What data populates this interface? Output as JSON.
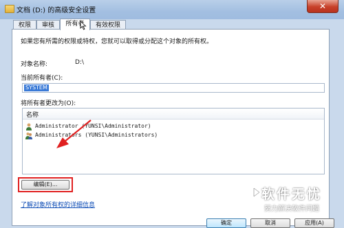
{
  "window": {
    "title": "文档 (D:) 的高级安全设置",
    "close_label": "✕"
  },
  "tabs": [
    {
      "label": "权限",
      "active": false
    },
    {
      "label": "审核",
      "active": false
    },
    {
      "label": "所有者",
      "active": true
    },
    {
      "label": "有效权限",
      "active": false
    }
  ],
  "panel": {
    "intro": "如果您有所需的权限或特权，您就可以取得或分配这个对象的所有权。",
    "object_label": "对象名称:",
    "object_value": "D:\\",
    "current_owner_label": "当前所有者(C):",
    "current_owner_value": "SYSTEM",
    "change_owner_label": "将所有者更改为(O):",
    "list_header": "名称",
    "owners": [
      {
        "name": "Administrator (YUNSI\\Administrator)",
        "icon": "user-icon"
      },
      {
        "name": "Administrators (YUNSI\\Administrators)",
        "icon": "group-icon"
      }
    ],
    "edit_button": "编辑(E)...",
    "learn_more_link": "了解对象所有权的详细信息"
  },
  "buttons": {
    "ok": "确定",
    "cancel": "取消",
    "apply": "应用(A)"
  },
  "watermark": {
    "title": "软件无忧",
    "subtitle": "努力解决软件问题"
  },
  "colors": {
    "highlight": "#e02020",
    "selection": "#3a7ad7",
    "link": "#0b4bb5"
  }
}
